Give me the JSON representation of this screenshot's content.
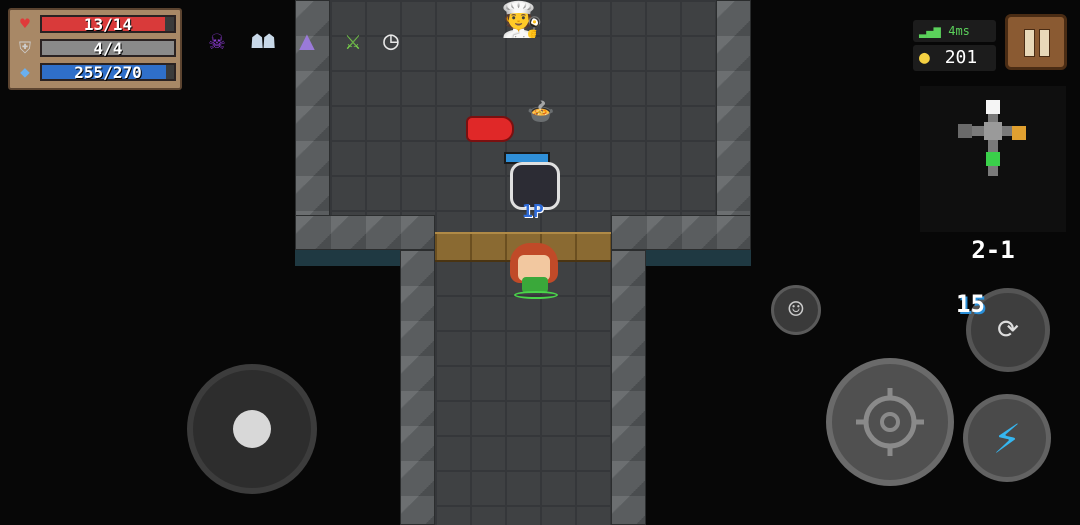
{
  "hud": {
    "hp": {
      "value": "13/14",
      "fraction": 0.93,
      "color": "#d93a3a",
      "icon": "heart-icon"
    },
    "armor": {
      "value": "4/4",
      "fraction": 1.0,
      "color": "#8a8a8a",
      "icon": "shield-icon"
    },
    "energy": {
      "value": "255/270",
      "fraction": 0.94,
      "color": "#2f6fc9",
      "icon": "energy-crystal-icon"
    }
  },
  "buffs": [
    "demon-mask-icon",
    "skeleton-icon",
    "wizard-hat-icon",
    "sword-icon",
    "clock-icon"
  ],
  "network": {
    "latency": "4ms",
    "signal_color": "#5bd15b"
  },
  "coins": {
    "count": "201",
    "icon": "coin-icon"
  },
  "level": {
    "label": "2-1"
  },
  "weapon": {
    "ammo": "15",
    "icon": "gauntlet-icon"
  },
  "player": {
    "tag": "1P"
  },
  "controls": {
    "joystick": "joystick",
    "emote_icon": "smiley-icon",
    "attack_icon": "crosshair-icon",
    "skill_icon": "lightning-icon"
  }
}
